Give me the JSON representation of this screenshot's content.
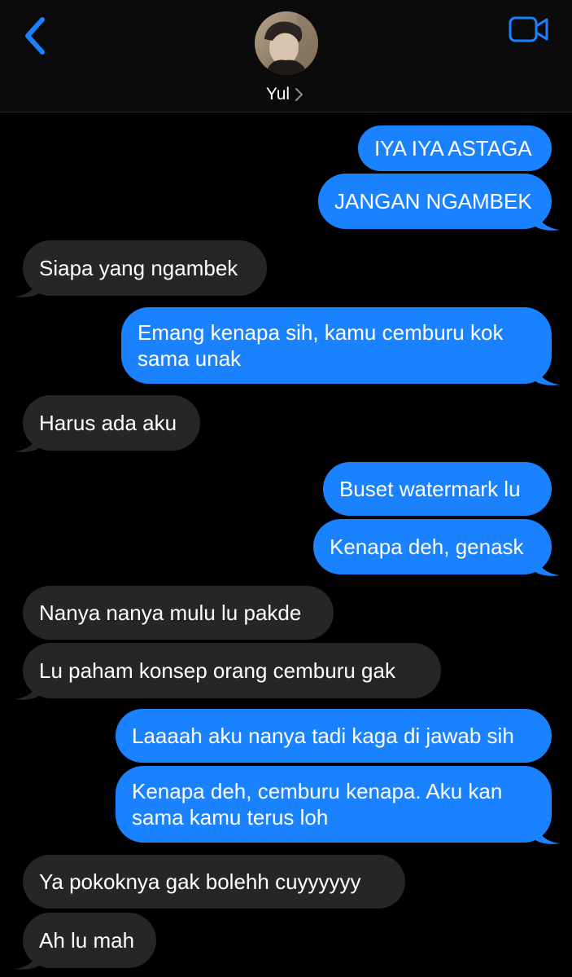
{
  "header": {
    "contact_name": "Yul",
    "back_icon": "chevron-left-icon",
    "video_icon": "video-call-icon",
    "accent_color": "#1a82ff"
  },
  "messages": [
    {
      "id": "m1",
      "side": "sent",
      "text": "IYA IYA ASTAGA"
    },
    {
      "id": "m2",
      "side": "sent",
      "text": "JANGAN NGAMBEK"
    },
    {
      "id": "m3",
      "side": "received",
      "text": "Siapa yang ngambek"
    },
    {
      "id": "m4",
      "side": "sent",
      "text": "Emang kenapa sih, kamu cemburu kok sama unak"
    },
    {
      "id": "m5",
      "side": "received",
      "text": "Harus ada aku"
    },
    {
      "id": "m6",
      "side": "sent",
      "text": "Buset watermark lu"
    },
    {
      "id": "m7",
      "side": "sent",
      "text": "Kenapa deh, genask"
    },
    {
      "id": "m8",
      "side": "received",
      "text": "Nanya nanya mulu lu pakde"
    },
    {
      "id": "m9",
      "side": "received",
      "text": "Lu paham konsep orang cemburu gak"
    },
    {
      "id": "m10",
      "side": "sent",
      "text": "Laaaah aku nanya tadi kaga di jawab sih"
    },
    {
      "id": "m11",
      "side": "sent",
      "text": "Kenapa deh, cemburu kenapa. Aku kan sama kamu terus loh"
    },
    {
      "id": "m12",
      "side": "received",
      "text": "Ya pokoknya gak bolehh cuyyyyyy"
    },
    {
      "id": "m13",
      "side": "received",
      "text": "Ah lu mah"
    }
  ],
  "colors": {
    "sent_bubble": "#1a82ff",
    "received_bubble": "#262628",
    "background": "#000000"
  }
}
